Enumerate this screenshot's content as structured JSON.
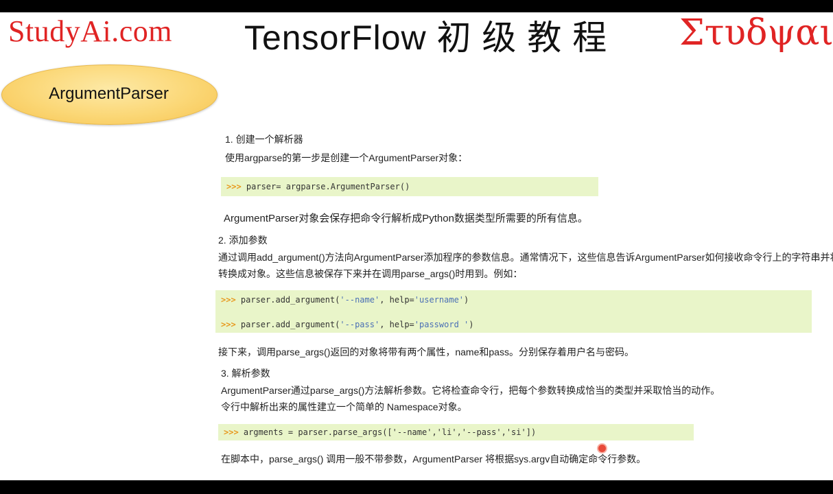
{
  "header": {
    "brand_left": "StudyAi.com",
    "title": "TensorFlow 初 级 教 程",
    "brand_right": "Στυδψαι",
    "brand_color": "#e02424"
  },
  "badge": {
    "label": "ArgumentParser"
  },
  "section1": {
    "heading": "1.    创建一个解析器",
    "desc": "使用argparse的第一步是创建一个ArgumentParser对象：",
    "code": [
      ">>>",
      " parser= argparse.ArgumentParser()"
    ],
    "after": "ArgumentParser对象会保存把命令行解析成Python数据类型所需要的所有信息。"
  },
  "section2": {
    "heading": "2.    添加参数",
    "desc1": "通过调用add_argument()方法向ArgumentParser添加程序的参数信息。通常情况下，这些信息告诉ArgumentParser如何接收命令行上的字符串并将",
    "desc2": "转换成对象。这些信息被保存下来并在调用parse_args()时用到。例如：",
    "code1": {
      "prompt": ">>>",
      "pre": " parser.add_argument(",
      "s1": "'--name'",
      "mid": ", help=",
      "s2": "'username'",
      "end": ")"
    },
    "code2": {
      "prompt": ">>>",
      "pre": " parser.add_argument(",
      "s1": "'--pass'",
      "mid": ", help=",
      "s2": "'password '",
      "end": ")"
    },
    "after": "接下来，调用parse_args()返回的对象将带有两个属性，name和pass。分别保存着用户名与密码。"
  },
  "section3": {
    "heading": "3.    解析参数",
    "desc1": "ArgumentParser通过parse_args()方法解析参数。它将检查命令行，把每个参数转换成恰当的类型并采取恰当的动作。",
    "desc2": "令行中解析出来的属性建立一个简单的 Namespace对象。",
    "code": {
      "prompt": ">>>",
      "text": " argments = parser.parse_args(['--name','li','--pass','si'])"
    },
    "after": "在脚本中，parse_args() 调用一般不带参数，ArgumentParser 将根据sys.argv自动确定命令行参数。"
  },
  "colors": {
    "code_bg": "#e9f5c9",
    "prompt": "#e89a20",
    "string": "#4a6fb5",
    "badge": "#fbd776"
  }
}
